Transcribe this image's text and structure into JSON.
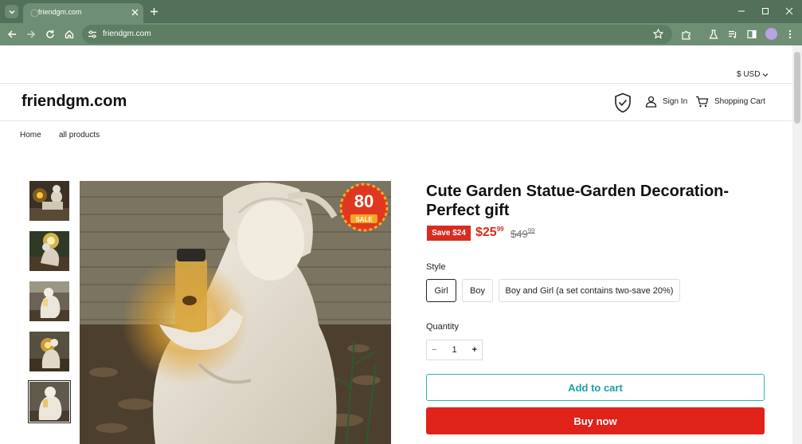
{
  "browser": {
    "tab_title": "friendgm.com",
    "url": "friendgm.com",
    "frame_color": "#53705a"
  },
  "header": {
    "currency": "$ USD",
    "logo": "friendgm.com",
    "sign_in": "Sign In",
    "cart": "Shopping Cart"
  },
  "breadcrumb": [
    "Home",
    "all products"
  ],
  "gallery": {
    "badge_number": "80",
    "badge_text": "SALE",
    "thumbnail_count": 5,
    "selected_thumbnail": 5
  },
  "product": {
    "title": "Cute Garden Statue-Garden Decoration-Perfect gift",
    "save_badge": "Save $24",
    "price_main": "$25",
    "price_cents": "99",
    "compare_main": "$49",
    "compare_cents": "99",
    "style_label": "Style",
    "style_options": [
      "Girl",
      "Boy",
      "Boy and Girl (a set contains two-save 20%)"
    ],
    "selected_style": "Girl",
    "quantity_label": "Quantity",
    "quantity_value": "1",
    "minus": "−",
    "plus": "+",
    "add_to_cart": "Add to cart",
    "buy_now": "Buy now"
  },
  "colors": {
    "accent_red": "#d72c20",
    "accent_teal": "#2eb2b5"
  }
}
